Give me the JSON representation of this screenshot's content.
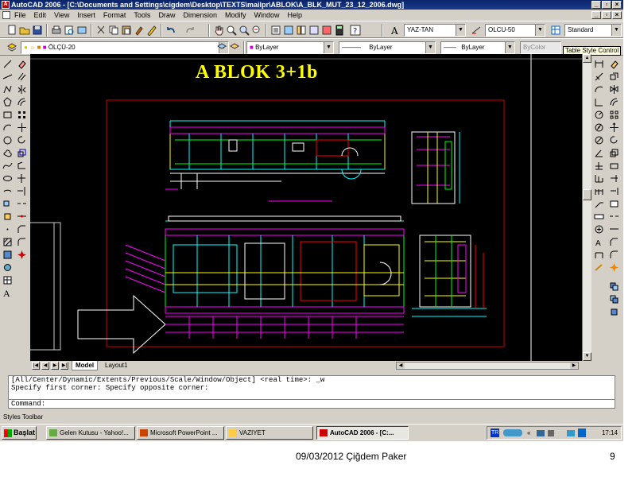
{
  "window": {
    "title": "AutoCAD 2006 - [C:\\Documents and Settings\\cigdem\\Desktop\\TEXTS\\mailpr\\ABLOK\\A_BLK_MUT_23_12_2006.dwg]"
  },
  "menu": {
    "items": [
      "File",
      "Edit",
      "View",
      "Insert",
      "Format",
      "Tools",
      "Draw",
      "Dimension",
      "Modify",
      "Window",
      "Help"
    ]
  },
  "toolbar": {
    "text_style": "YAZ-TAN",
    "dim_style": "OLCU-50",
    "table_style": "Standard",
    "layer": "ÖLÇÜ-20",
    "color": "ByLayer",
    "linetype": "ByLayer",
    "lineweight": "ByLayer",
    "plotstyle": "ByColor"
  },
  "tooltip": "Table Style Control",
  "drawing": {
    "title": "A BLOK  3+1b"
  },
  "tabs": {
    "model": "Model",
    "layout": "Layout1"
  },
  "command": {
    "line1": "[All/Center/Dynamic/Extents/Previous/Scale/Window/Object] <real time>: _w",
    "line2": "Specify first corner: Specify opposite corner:",
    "prompt": "Command:"
  },
  "status": {
    "text": "Styles Toolbar"
  },
  "taskbar": {
    "start": "Başlat",
    "tasks": [
      "Gelen Kutusu - Yahoo!...",
      "Microsoft PowerPoint ...",
      "VAZIYET",
      "AutoCAD 2006 - [C:..."
    ],
    "lang": "TR",
    "clock": "17:14"
  },
  "footer": {
    "text": "09/03/2012 Çiğdem Paker",
    "page": "9"
  },
  "colors": {
    "titlebar": "#0a246a",
    "canvas": "#000000",
    "drawing_title": "#ffff00",
    "border_red": "#cc0000"
  }
}
